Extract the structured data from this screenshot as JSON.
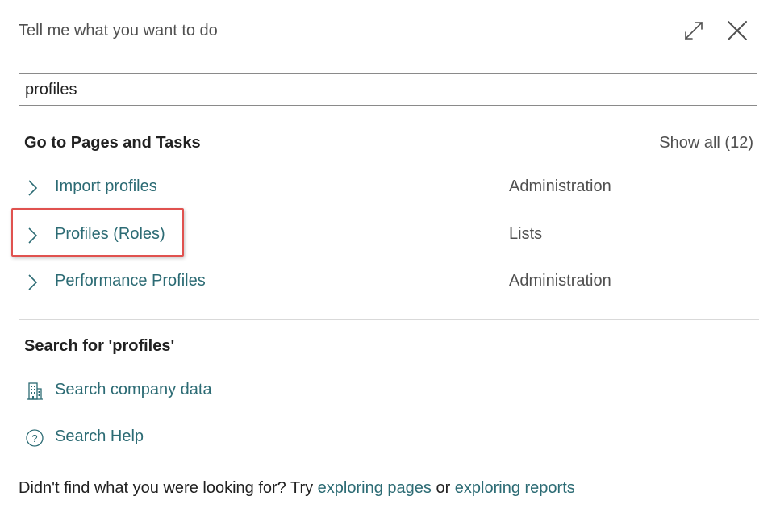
{
  "dialog": {
    "title": "Tell me what you want to do"
  },
  "search": {
    "value": "profiles",
    "placeholder": ""
  },
  "pages_section": {
    "title": "Go to Pages and Tasks",
    "show_all": "Show all (12)",
    "results": [
      {
        "label": "Import profiles",
        "category": "Administration",
        "icon": "chevron-right-icon"
      },
      {
        "label": "Profiles (Roles)",
        "category": "Lists",
        "icon": "chevron-right-icon",
        "highlighted": true
      },
      {
        "label": "Performance Profiles",
        "category": "Administration",
        "icon": "chevron-right-icon"
      }
    ]
  },
  "search_section": {
    "title": "Search for 'profiles'",
    "actions": [
      {
        "label": "Search company data",
        "icon": "building-icon"
      },
      {
        "label": "Search Help",
        "icon": "help-circle-icon"
      }
    ]
  },
  "footer": {
    "prefix": "Didn't find what you were looking for? Try ",
    "link1": "exploring pages",
    "middle": " or ",
    "link2": "exploring reports"
  },
  "colors": {
    "link": "#2c6b74",
    "highlight_border": "#e0524f",
    "muted_text": "#505050"
  }
}
